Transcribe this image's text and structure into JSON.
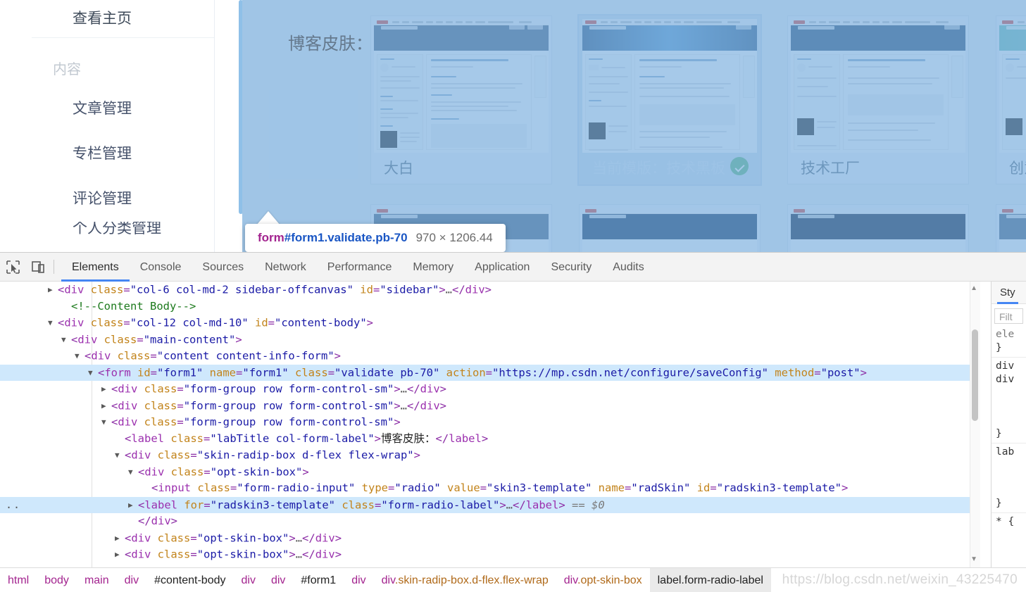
{
  "page": {
    "sidebar": {
      "top_item": "查看主页",
      "section_label": "内容",
      "items": [
        {
          "label": "文章管理"
        },
        {
          "label": "专栏管理"
        },
        {
          "label": "评论管理"
        },
        {
          "label": "个人分类管理"
        }
      ]
    },
    "form": {
      "skin_label": "博客皮肤：",
      "skins": [
        {
          "name": "大白",
          "selected": false
        },
        {
          "name": "当前模版：技术黑板",
          "selected": true
        },
        {
          "name": "技术工厂",
          "selected": false
        },
        {
          "name": "创意",
          "selected": false
        }
      ]
    }
  },
  "tooltip": {
    "tag": "form",
    "id": "#form1",
    "classes": ".validate.pb-70",
    "dimensions": "970 × 1206.44"
  },
  "devtools": {
    "icons": {
      "inspect": "cursor-select-icon",
      "device": "device-toolbar-icon"
    },
    "tabs": [
      {
        "label": "Elements",
        "active": true
      },
      {
        "label": "Console",
        "active": false
      },
      {
        "label": "Sources",
        "active": false
      },
      {
        "label": "Network",
        "active": false
      },
      {
        "label": "Performance",
        "active": false
      },
      {
        "label": "Memory",
        "active": false
      },
      {
        "label": "Application",
        "active": false
      },
      {
        "label": "Security",
        "active": false
      },
      {
        "label": "Audits",
        "active": false
      }
    ],
    "tree": [
      {
        "indent": 0,
        "twisty": "closed",
        "selected": false,
        "parts": [
          {
            "t": "pun",
            "s": "<"
          },
          {
            "t": "tag",
            "s": "div"
          },
          {
            "t": "attr",
            "s": " class"
          },
          {
            "t": "pun",
            "s": "="
          },
          {
            "t": "val",
            "s": "\"col-6 col-md-2 sidebar-offcanvas\""
          },
          {
            "t": "attr",
            "s": " id"
          },
          {
            "t": "pun",
            "s": "="
          },
          {
            "t": "val",
            "s": "\"sidebar\""
          },
          {
            "t": "pun",
            "s": ">"
          },
          {
            "t": "ellip",
            "s": "…"
          },
          {
            "t": "pun",
            "s": "</"
          },
          {
            "t": "tag",
            "s": "div"
          },
          {
            "t": "pun",
            "s": ">"
          }
        ]
      },
      {
        "indent": 1,
        "twisty": "none",
        "selected": false,
        "parts": [
          {
            "t": "cmt",
            "s": "<!--Content Body-->"
          }
        ]
      },
      {
        "indent": 0,
        "twisty": "open",
        "selected": false,
        "parts": [
          {
            "t": "pun",
            "s": "<"
          },
          {
            "t": "tag",
            "s": "div"
          },
          {
            "t": "attr",
            "s": " class"
          },
          {
            "t": "pun",
            "s": "="
          },
          {
            "t": "val",
            "s": "\"col-12 col-md-10\""
          },
          {
            "t": "attr",
            "s": " id"
          },
          {
            "t": "pun",
            "s": "="
          },
          {
            "t": "val",
            "s": "\"content-body\""
          },
          {
            "t": "pun",
            "s": ">"
          }
        ]
      },
      {
        "indent": 1,
        "twisty": "open",
        "selected": false,
        "parts": [
          {
            "t": "pun",
            "s": "<"
          },
          {
            "t": "tag",
            "s": "div"
          },
          {
            "t": "attr",
            "s": " class"
          },
          {
            "t": "pun",
            "s": "="
          },
          {
            "t": "val",
            "s": "\"main-content\""
          },
          {
            "t": "pun",
            "s": ">"
          }
        ]
      },
      {
        "indent": 2,
        "twisty": "open",
        "selected": false,
        "parts": [
          {
            "t": "pun",
            "s": "<"
          },
          {
            "t": "tag",
            "s": "div"
          },
          {
            "t": "attr",
            "s": " class"
          },
          {
            "t": "pun",
            "s": "="
          },
          {
            "t": "val",
            "s": "\"content content-info-form\""
          },
          {
            "t": "pun",
            "s": ">"
          }
        ]
      },
      {
        "indent": 3,
        "twisty": "open",
        "selected": true,
        "parts": [
          {
            "t": "pun",
            "s": "<"
          },
          {
            "t": "tag",
            "s": "form"
          },
          {
            "t": "attr",
            "s": " id"
          },
          {
            "t": "pun",
            "s": "="
          },
          {
            "t": "val",
            "s": "\"form1\""
          },
          {
            "t": "attr",
            "s": " name"
          },
          {
            "t": "pun",
            "s": "="
          },
          {
            "t": "val",
            "s": "\"form1\""
          },
          {
            "t": "attr",
            "s": " class"
          },
          {
            "t": "pun",
            "s": "="
          },
          {
            "t": "val",
            "s": "\"validate pb-70\""
          },
          {
            "t": "attr",
            "s": " action"
          },
          {
            "t": "pun",
            "s": "="
          },
          {
            "t": "val",
            "s": "\"https://mp.csdn.net/configure/saveConfig\""
          },
          {
            "t": "attr",
            "s": " method"
          },
          {
            "t": "pun",
            "s": "="
          },
          {
            "t": "val",
            "s": "\"post\""
          },
          {
            "t": "pun",
            "s": ">"
          }
        ]
      },
      {
        "indent": 4,
        "twisty": "closed",
        "selected": false,
        "parts": [
          {
            "t": "pun",
            "s": "<"
          },
          {
            "t": "tag",
            "s": "div"
          },
          {
            "t": "attr",
            "s": " class"
          },
          {
            "t": "pun",
            "s": "="
          },
          {
            "t": "val",
            "s": "\"form-group row form-control-sm\""
          },
          {
            "t": "pun",
            "s": ">"
          },
          {
            "t": "ellip",
            "s": "…"
          },
          {
            "t": "pun",
            "s": "</"
          },
          {
            "t": "tag",
            "s": "div"
          },
          {
            "t": "pun",
            "s": ">"
          }
        ]
      },
      {
        "indent": 4,
        "twisty": "closed",
        "selected": false,
        "parts": [
          {
            "t": "pun",
            "s": "<"
          },
          {
            "t": "tag",
            "s": "div"
          },
          {
            "t": "attr",
            "s": " class"
          },
          {
            "t": "pun",
            "s": "="
          },
          {
            "t": "val",
            "s": "\"form-group row form-control-sm\""
          },
          {
            "t": "pun",
            "s": ">"
          },
          {
            "t": "ellip",
            "s": "…"
          },
          {
            "t": "pun",
            "s": "</"
          },
          {
            "t": "tag",
            "s": "div"
          },
          {
            "t": "pun",
            "s": ">"
          }
        ]
      },
      {
        "indent": 4,
        "twisty": "open",
        "selected": false,
        "parts": [
          {
            "t": "pun",
            "s": "<"
          },
          {
            "t": "tag",
            "s": "div"
          },
          {
            "t": "attr",
            "s": " class"
          },
          {
            "t": "pun",
            "s": "="
          },
          {
            "t": "val",
            "s": "\"form-group row form-control-sm\""
          },
          {
            "t": "pun",
            "s": ">"
          }
        ]
      },
      {
        "indent": 5,
        "twisty": "none",
        "selected": false,
        "parts": [
          {
            "t": "pun",
            "s": "<"
          },
          {
            "t": "tag",
            "s": "label"
          },
          {
            "t": "attr",
            "s": " class"
          },
          {
            "t": "pun",
            "s": "="
          },
          {
            "t": "val",
            "s": "\"labTitle col-form-label\""
          },
          {
            "t": "pun",
            "s": ">"
          },
          {
            "t": "txt",
            "s": "博客皮肤："
          },
          {
            "t": "pun",
            "s": "</"
          },
          {
            "t": "tag",
            "s": "label"
          },
          {
            "t": "pun",
            "s": ">"
          }
        ]
      },
      {
        "indent": 5,
        "twisty": "open",
        "selected": false,
        "parts": [
          {
            "t": "pun",
            "s": "<"
          },
          {
            "t": "tag",
            "s": "div"
          },
          {
            "t": "attr",
            "s": " class"
          },
          {
            "t": "pun",
            "s": "="
          },
          {
            "t": "val",
            "s": "\"skin-radip-box d-flex flex-wrap\""
          },
          {
            "t": "pun",
            "s": ">"
          }
        ]
      },
      {
        "indent": 6,
        "twisty": "open",
        "selected": false,
        "parts": [
          {
            "t": "pun",
            "s": "<"
          },
          {
            "t": "tag",
            "s": "div"
          },
          {
            "t": "attr",
            "s": " class"
          },
          {
            "t": "pun",
            "s": "="
          },
          {
            "t": "val",
            "s": "\"opt-skin-box\""
          },
          {
            "t": "pun",
            "s": ">"
          }
        ]
      },
      {
        "indent": 7,
        "twisty": "none",
        "selected": false,
        "parts": [
          {
            "t": "pun",
            "s": "<"
          },
          {
            "t": "tag",
            "s": "input"
          },
          {
            "t": "attr",
            "s": " class"
          },
          {
            "t": "pun",
            "s": "="
          },
          {
            "t": "val",
            "s": "\"form-radio-input\""
          },
          {
            "t": "attr",
            "s": " type"
          },
          {
            "t": "pun",
            "s": "="
          },
          {
            "t": "val",
            "s": "\"radio\""
          },
          {
            "t": "attr",
            "s": " value"
          },
          {
            "t": "pun",
            "s": "="
          },
          {
            "t": "val",
            "s": "\"skin3-template\""
          },
          {
            "t": "attr",
            "s": " name"
          },
          {
            "t": "pun",
            "s": "="
          },
          {
            "t": "val",
            "s": "\"radSkin\""
          },
          {
            "t": "attr",
            "s": " id"
          },
          {
            "t": "pun",
            "s": "="
          },
          {
            "t": "val",
            "s": "\"radskin3-template\""
          },
          {
            "t": "pun",
            "s": ">"
          }
        ]
      },
      {
        "indent": 6,
        "twisty": "closed",
        "selected": true,
        "dots": true,
        "parts": [
          {
            "t": "pun",
            "s": "<"
          },
          {
            "t": "tag",
            "s": "label"
          },
          {
            "t": "attr",
            "s": " for"
          },
          {
            "t": "pun",
            "s": "="
          },
          {
            "t": "val",
            "s": "\"radskin3-template\""
          },
          {
            "t": "attr",
            "s": " class"
          },
          {
            "t": "pun",
            "s": "="
          },
          {
            "t": "val",
            "s": "\"form-radio-label\""
          },
          {
            "t": "pun",
            "s": ">"
          },
          {
            "t": "ellip",
            "s": "…"
          },
          {
            "t": "pun",
            "s": "</"
          },
          {
            "t": "tag",
            "s": "label"
          },
          {
            "t": "pun",
            "s": ">"
          },
          {
            "t": "dollar",
            "s": " == $0"
          }
        ]
      },
      {
        "indent": 6,
        "twisty": "none",
        "selected": false,
        "parts": [
          {
            "t": "pun",
            "s": "</"
          },
          {
            "t": "tag",
            "s": "div"
          },
          {
            "t": "pun",
            "s": ">"
          }
        ]
      },
      {
        "indent": 5,
        "twisty": "closed",
        "selected": false,
        "parts": [
          {
            "t": "pun",
            "s": "<"
          },
          {
            "t": "tag",
            "s": "div"
          },
          {
            "t": "attr",
            "s": " class"
          },
          {
            "t": "pun",
            "s": "="
          },
          {
            "t": "val",
            "s": "\"opt-skin-box\""
          },
          {
            "t": "pun",
            "s": ">"
          },
          {
            "t": "ellip",
            "s": "…"
          },
          {
            "t": "pun",
            "s": "</"
          },
          {
            "t": "tag",
            "s": "div"
          },
          {
            "t": "pun",
            "s": ">"
          }
        ]
      },
      {
        "indent": 5,
        "twisty": "closed",
        "selected": false,
        "parts": [
          {
            "t": "pun",
            "s": "<"
          },
          {
            "t": "tag",
            "s": "div"
          },
          {
            "t": "attr",
            "s": " class"
          },
          {
            "t": "pun",
            "s": "="
          },
          {
            "t": "val",
            "s": "\"opt-skin-box\""
          },
          {
            "t": "pun",
            "s": ">"
          },
          {
            "t": "ellip",
            "s": "…"
          },
          {
            "t": "pun",
            "s": "</"
          },
          {
            "t": "tag",
            "s": "div"
          },
          {
            "t": "pun",
            "s": ">"
          }
        ]
      }
    ],
    "styles_pane": {
      "tab_label": "Sty",
      "filter_placeholder": "Filt",
      "lines": [
        "ele",
        "}",
        "div",
        "div",
        "}",
        "lab",
        "}",
        "* {"
      ]
    },
    "breadcrumb": [
      {
        "label": "html",
        "kind": "tagname",
        "active": false
      },
      {
        "label": "body",
        "kind": "tagname",
        "active": false
      },
      {
        "label": "main",
        "kind": "tagname",
        "active": false
      },
      {
        "label": "div",
        "kind": "tagname",
        "active": false
      },
      {
        "label": "#content-body",
        "kind": "idname",
        "active": false
      },
      {
        "label": "div",
        "kind": "tagname",
        "active": false
      },
      {
        "label": "div",
        "kind": "tagname",
        "active": false
      },
      {
        "label": "#form1",
        "kind": "idname",
        "active": false
      },
      {
        "label": "div",
        "kind": "tagname",
        "active": false
      },
      {
        "label": "div.skin-radip-box.d-flex.flex-wrap",
        "kind": "mixed",
        "tag": "div",
        "cls": ".skin-radip-box.d-flex.flex-wrap",
        "active": false
      },
      {
        "label": "div.opt-skin-box",
        "kind": "mixed",
        "tag": "div",
        "cls": ".opt-skin-box",
        "active": false
      },
      {
        "label": "label.form-radio-label",
        "kind": "idname",
        "active": true
      }
    ]
  },
  "watermark": "https://blog.csdn.net/weixin_43225470",
  "colors": {
    "inspect_overlay": "#6fa8dc",
    "devtools_active_tab": "#4586f3",
    "selected_row": "#cfe8fc",
    "check_green": "#6fbf8b",
    "tag_purple": "#9b2fae",
    "attr_orange": "#c2831a",
    "value_blue": "#1a1aa6"
  }
}
